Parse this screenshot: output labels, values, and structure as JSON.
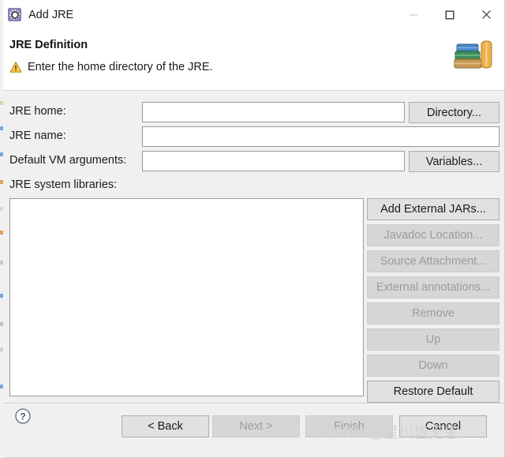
{
  "window": {
    "title": "Add JRE",
    "app_icon": "gear-icon",
    "controls": {
      "minimize": "minimize-icon",
      "maximize": "maximize-icon",
      "close": "close-icon"
    }
  },
  "header": {
    "title": "JRE Definition",
    "status_icon": "warning-icon",
    "status_message": "Enter the home directory of the JRE.",
    "decoration_icon": "books-icon"
  },
  "form": {
    "jre_home": {
      "label": "JRE home:",
      "value": "",
      "placeholder": ""
    },
    "jre_name": {
      "label": "JRE name:",
      "value": "",
      "placeholder": ""
    },
    "vm_arguments": {
      "label": "Default VM arguments:",
      "value": "",
      "placeholder": ""
    },
    "system_libraries": {
      "label": "JRE system libraries:",
      "items": []
    },
    "directory_button": "Directory...",
    "variables_button": "Variables..."
  },
  "library_actions": [
    {
      "label": "Add External JARs...",
      "enabled": true
    },
    {
      "label": "Javadoc Location...",
      "enabled": false
    },
    {
      "label": "Source Attachment...",
      "enabled": false
    },
    {
      "label": "External annotations...",
      "enabled": false
    },
    {
      "label": "Remove",
      "enabled": false
    },
    {
      "label": "Up",
      "enabled": false
    },
    {
      "label": "Down",
      "enabled": false
    },
    {
      "label": "Restore Default",
      "enabled": true
    }
  ],
  "footer": {
    "help_icon": "help-icon",
    "buttons": [
      {
        "label": "< Back",
        "enabled": true
      },
      {
        "label": "Next >",
        "enabled": false
      },
      {
        "label": "Finish",
        "enabled": false
      },
      {
        "label": "Cancel",
        "enabled": true
      }
    ]
  },
  "watermark": "CSDN @星川皆无恙",
  "colors": {
    "accent": "#8d80b8",
    "warning": "#f0b429",
    "dialog_bg": "#f0f0f0",
    "field_bg": "#ffffff"
  }
}
